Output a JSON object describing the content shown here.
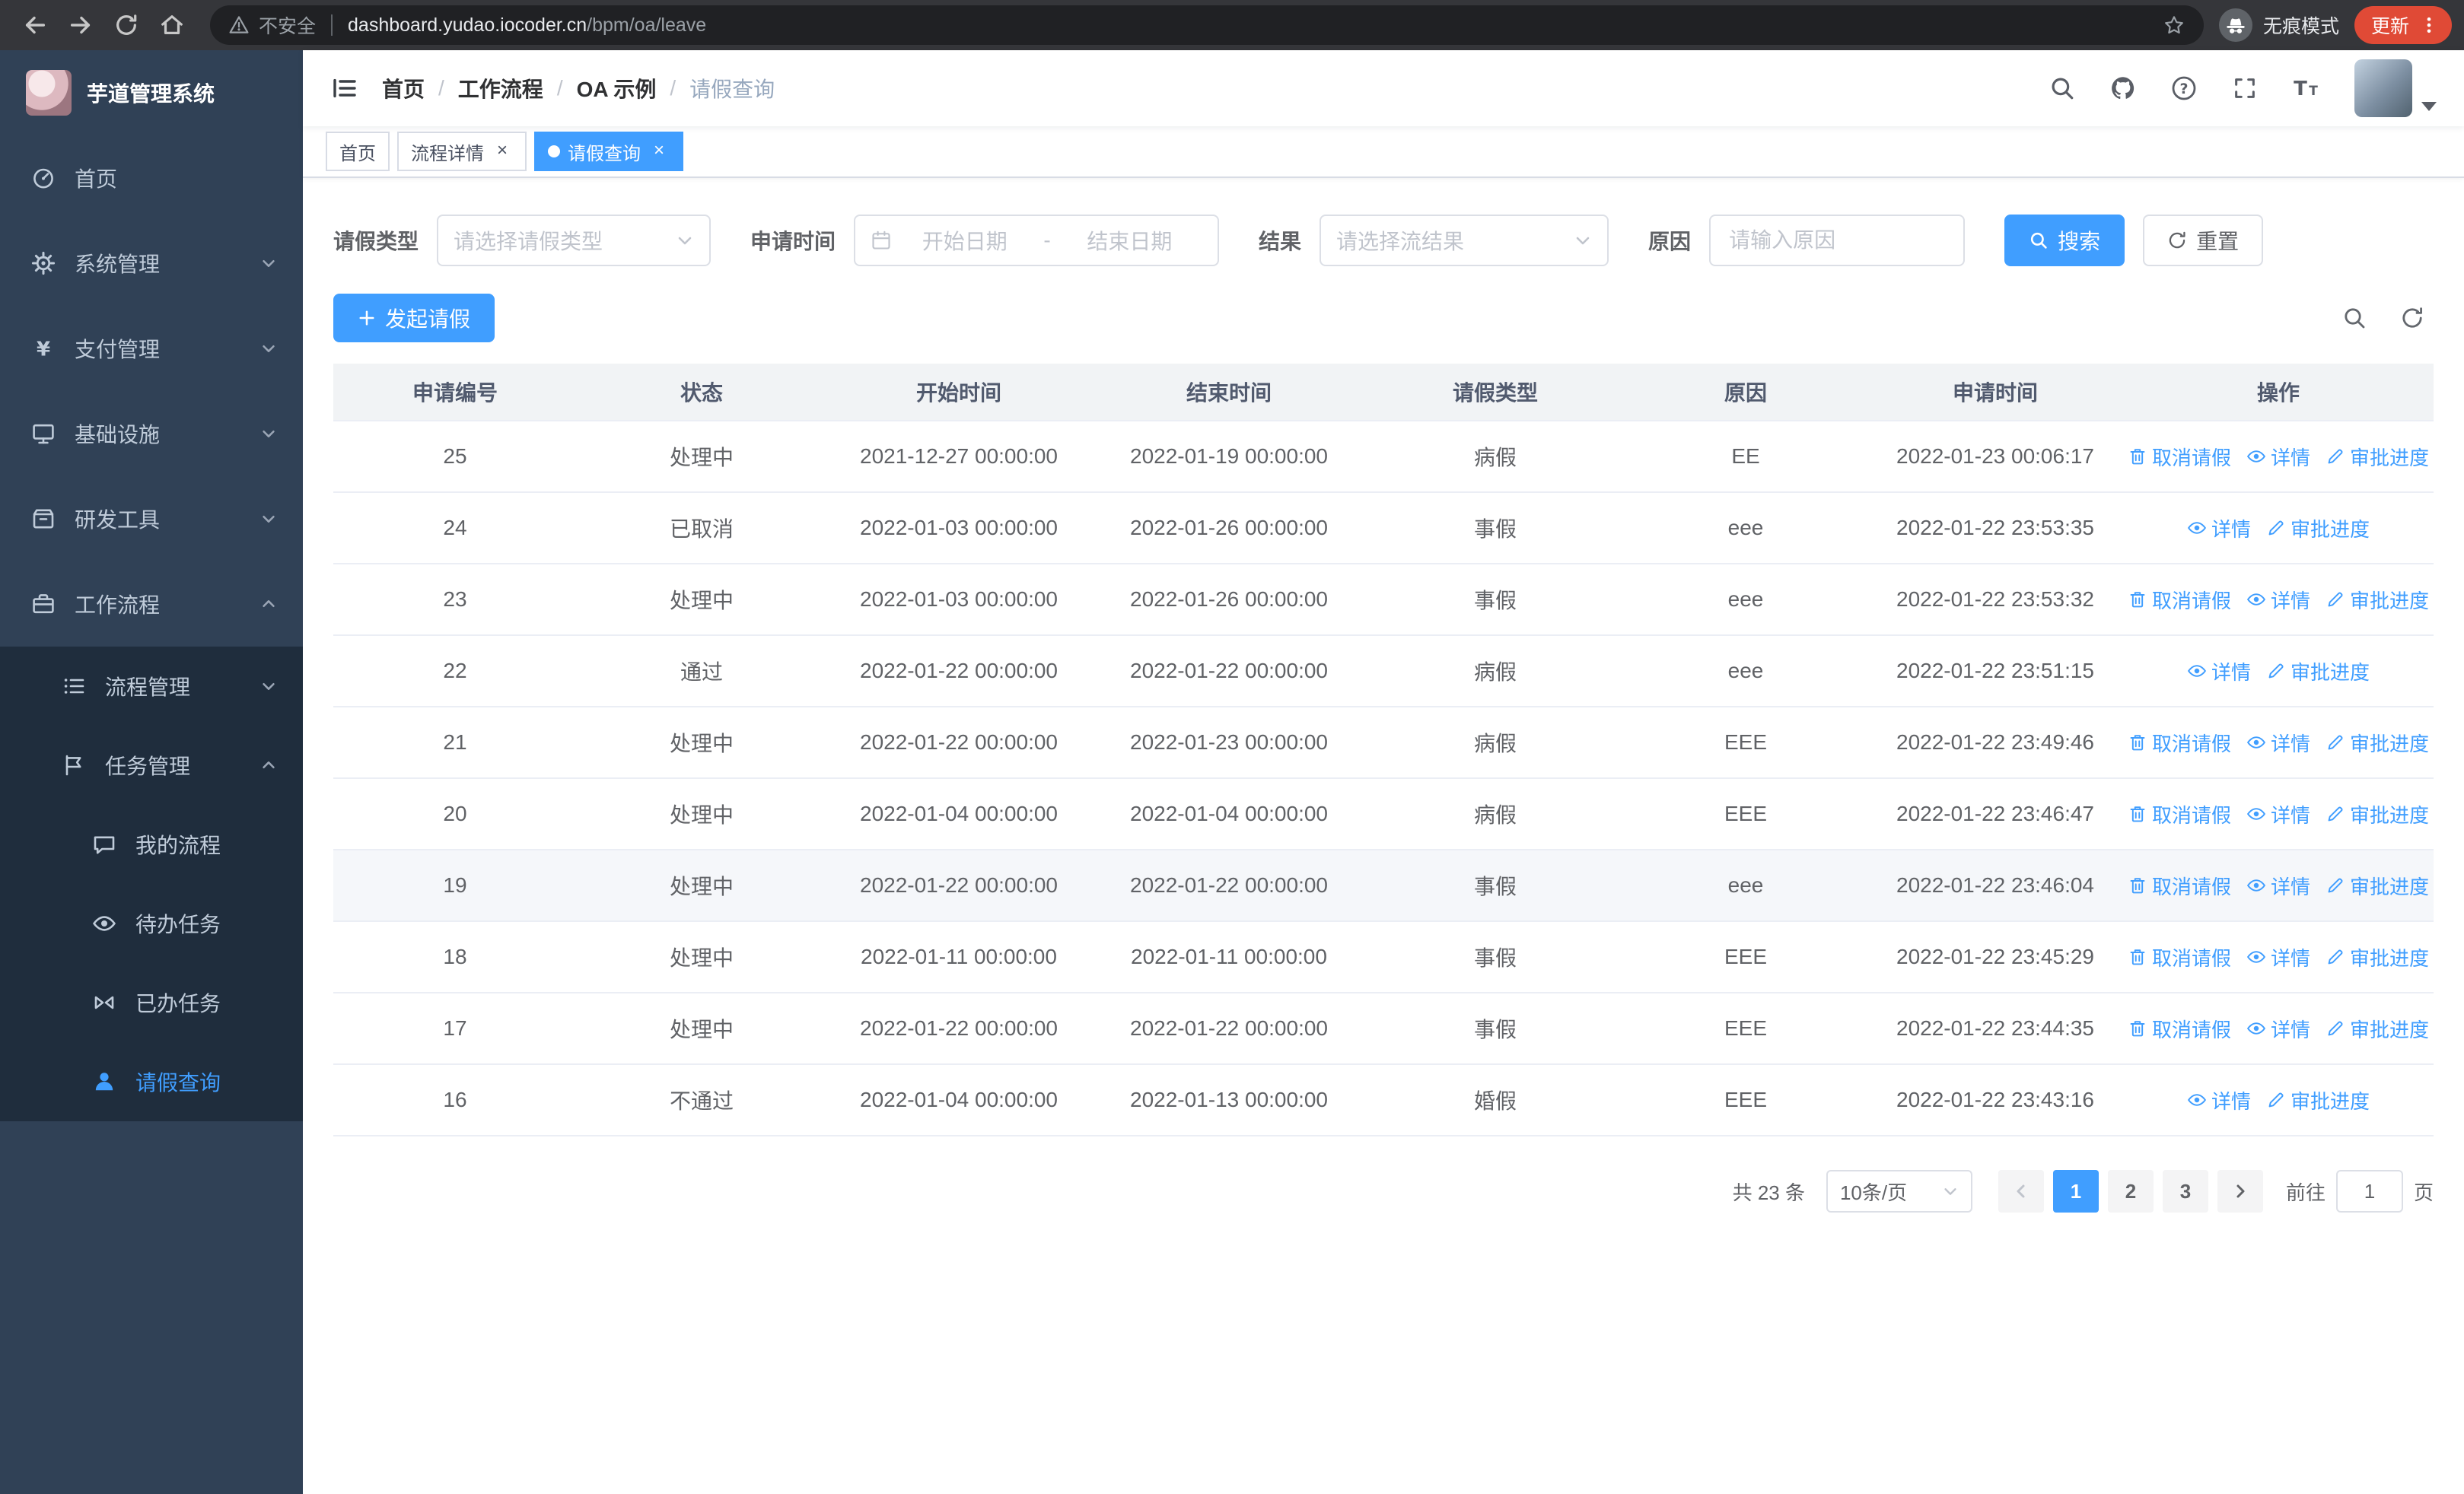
{
  "browser": {
    "security_label": "不安全",
    "url_domain": "dashboard.yudao.iocoder.cn",
    "url_path": "/bpm/oa/leave",
    "incognito_label": "无痕模式",
    "update_label": "更新"
  },
  "sidebar": {
    "title": "芋道管理系统",
    "items": [
      {
        "label": "首页",
        "icon": "dashboard-icon"
      },
      {
        "label": "系统管理",
        "icon": "gear-icon"
      },
      {
        "label": "支付管理",
        "icon": "yen-icon"
      },
      {
        "label": "基础设施",
        "icon": "monitor-icon"
      },
      {
        "label": "研发工具",
        "icon": "toolbox-icon"
      },
      {
        "label": "工作流程",
        "icon": "briefcase-icon"
      },
      {
        "label": "流程管理",
        "icon": "list-icon"
      },
      {
        "label": "任务管理",
        "icon": "flag-icon"
      },
      {
        "label": "我的流程",
        "icon": "chat-icon"
      },
      {
        "label": "待办任务",
        "icon": "eye-icon"
      },
      {
        "label": "已办任务",
        "icon": "done-icon"
      },
      {
        "label": "请假查询",
        "icon": "user-icon"
      }
    ]
  },
  "header": {
    "breadcrumb": [
      "首页",
      "工作流程",
      "OA 示例",
      "请假查询"
    ],
    "separator": "/"
  },
  "tabs": [
    {
      "label": "首页"
    },
    {
      "label": "流程详情"
    },
    {
      "label": "请假查询"
    }
  ],
  "filters": {
    "leave_type_label": "请假类型",
    "leave_type_placeholder": "请选择请假类型",
    "apply_time_label": "申请时间",
    "start_date_placeholder": "开始日期",
    "range_separator": "-",
    "end_date_placeholder": "结束日期",
    "result_label": "结果",
    "result_placeholder": "请选择流结果",
    "reason_label": "原因",
    "reason_placeholder": "请输入原因",
    "search_label": "搜索",
    "reset_label": "重置"
  },
  "toolbar": {
    "create_label": "发起请假"
  },
  "table": {
    "columns": [
      "申请编号",
      "状态",
      "开始时间",
      "结束时间",
      "请假类型",
      "原因",
      "申请时间",
      "操作"
    ],
    "actions_def": {
      "cancel": {
        "label": "取消请假",
        "icon": "delete-icon",
        "name": "cancel-leave-link"
      },
      "view": {
        "label": "详情",
        "icon": "eye-icon",
        "name": "detail-link"
      },
      "progress": {
        "label": "审批进度",
        "icon": "edit-icon",
        "name": "approval-progress-link"
      }
    },
    "rows": [
      {
        "id": "25",
        "status": "处理中",
        "start": "2021-12-27 00:00:00",
        "end": "2022-01-19 00:00:00",
        "type": "病假",
        "reason": "EE",
        "applied": "2022-01-23 00:06:17",
        "actions": [
          "cancel",
          "view",
          "progress"
        ]
      },
      {
        "id": "24",
        "status": "已取消",
        "start": "2022-01-03 00:00:00",
        "end": "2022-01-26 00:00:00",
        "type": "事假",
        "reason": "eee",
        "applied": "2022-01-22 23:53:35",
        "actions": [
          "view",
          "progress"
        ]
      },
      {
        "id": "23",
        "status": "处理中",
        "start": "2022-01-03 00:00:00",
        "end": "2022-01-26 00:00:00",
        "type": "事假",
        "reason": "eee",
        "applied": "2022-01-22 23:53:32",
        "actions": [
          "cancel",
          "view",
          "progress"
        ]
      },
      {
        "id": "22",
        "status": "通过",
        "start": "2022-01-22 00:00:00",
        "end": "2022-01-22 00:00:00",
        "type": "病假",
        "reason": "eee",
        "applied": "2022-01-22 23:51:15",
        "actions": [
          "view",
          "progress"
        ]
      },
      {
        "id": "21",
        "status": "处理中",
        "start": "2022-01-22 00:00:00",
        "end": "2022-01-23 00:00:00",
        "type": "病假",
        "reason": "EEE",
        "applied": "2022-01-22 23:49:46",
        "actions": [
          "cancel",
          "view",
          "progress"
        ]
      },
      {
        "id": "20",
        "status": "处理中",
        "start": "2022-01-04 00:00:00",
        "end": "2022-01-04 00:00:00",
        "type": "病假",
        "reason": "EEE",
        "applied": "2022-01-22 23:46:47",
        "actions": [
          "cancel",
          "view",
          "progress"
        ]
      },
      {
        "id": "19",
        "status": "处理中",
        "start": "2022-01-22 00:00:00",
        "end": "2022-01-22 00:00:00",
        "type": "事假",
        "reason": "eee",
        "applied": "2022-01-22 23:46:04",
        "actions": [
          "cancel",
          "view",
          "progress"
        ],
        "highlighted": true
      },
      {
        "id": "18",
        "status": "处理中",
        "start": "2022-01-11 00:00:00",
        "end": "2022-01-11 00:00:00",
        "type": "事假",
        "reason": "EEE",
        "applied": "2022-01-22 23:45:29",
        "actions": [
          "cancel",
          "view",
          "progress"
        ]
      },
      {
        "id": "17",
        "status": "处理中",
        "start": "2022-01-22 00:00:00",
        "end": "2022-01-22 00:00:00",
        "type": "事假",
        "reason": "EEE",
        "applied": "2022-01-22 23:44:35",
        "actions": [
          "cancel",
          "view",
          "progress"
        ]
      },
      {
        "id": "16",
        "status": "不通过",
        "start": "2022-01-04 00:00:00",
        "end": "2022-01-13 00:00:00",
        "type": "婚假",
        "reason": "EEE",
        "applied": "2022-01-22 23:43:16",
        "actions": [
          "view",
          "progress"
        ]
      }
    ]
  },
  "pagination": {
    "total_text": "共 23 条",
    "page_size_text": "10条/页",
    "pages": [
      "1",
      "2",
      "3"
    ],
    "active_page": "1",
    "goto_prefix": "前往",
    "goto_value": "1",
    "goto_suffix": "页"
  }
}
